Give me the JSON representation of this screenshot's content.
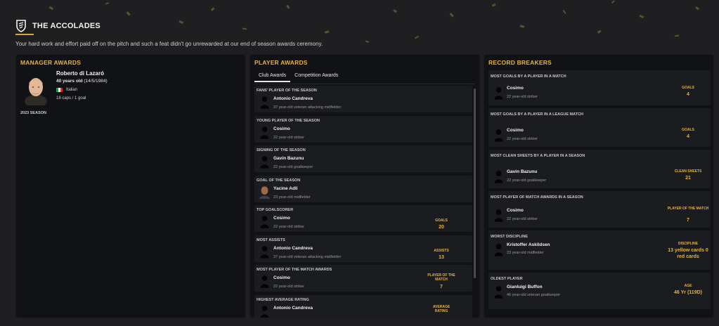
{
  "header": {
    "title": "THE ACCOLADES",
    "subtitle": "Your hard work and effort paid off on the pitch and such a feat didn't go unrewarded at our end of season awards ceremony.",
    "logo_icon": "accolades-shield-icon"
  },
  "colors": {
    "accent": "#e8b23a",
    "background": "#1f1f21",
    "panel": "#111215",
    "card": "#1b1c20"
  },
  "manager": {
    "title": "MANAGER AWARDS",
    "name": "Roberto di Lazaró",
    "age": "40 years old",
    "dob": "(14/5/1984)",
    "nationality": "Italian",
    "caps": "18 caps / 1 goal",
    "season": "2023 SEASON"
  },
  "player_awards": {
    "title": "PLAYER AWARDS",
    "tabs": [
      {
        "label": "Club Awards",
        "active": true
      },
      {
        "label": "Competition Awards",
        "active": false
      }
    ],
    "items": [
      {
        "category": "FANS' PLAYER OF THE SEASON",
        "name": "Antonio Candreva",
        "desc": "37 year-old veteran attacking midfielder",
        "stat_label": "",
        "stat_value": ""
      },
      {
        "category": "YOUNG PLAYER OF THE SEASON",
        "name": "Cosimo",
        "desc": "22 year-old striker",
        "stat_label": "",
        "stat_value": ""
      },
      {
        "category": "SIGNING OF THE SEASON",
        "name": "Gavin Bazunu",
        "desc": "22 year-old goalkeeper",
        "stat_label": "",
        "stat_value": ""
      },
      {
        "category": "GOAL OF THE SEASON",
        "name": "Yacine Adli",
        "desc": "23 year-old midfielder",
        "stat_label": "",
        "stat_value": ""
      },
      {
        "category": "TOP GOALSCORER",
        "name": "Cosimo",
        "desc": "22 year-old striker",
        "stat_label": "GOALS",
        "stat_value": "20"
      },
      {
        "category": "MOST ASSISTS",
        "name": "Antonio Candreva",
        "desc": "37 year-old veteran attacking midfielder",
        "stat_label": "ASSISTS",
        "stat_value": "13"
      },
      {
        "category": "MOST PLAYER OF THE MATCH AWARDS",
        "name": "Cosimo",
        "desc": "22 year-old striker",
        "stat_label": "PLAYER OF THE MATCH",
        "stat_value": "7"
      },
      {
        "category": "HIGHEST AVERAGE RATING",
        "name": "Antonio Candreva",
        "desc": "",
        "stat_label": "AVERAGE RATING",
        "stat_value": ""
      }
    ]
  },
  "records": {
    "title": "RECORD BREAKERS",
    "items": [
      {
        "category": "MOST GOALS BY A PLAYER IN A MATCH",
        "name": "Cosimo",
        "desc": "22 year-old striker",
        "stat_label": "GOALS",
        "stat_value": "4"
      },
      {
        "category": "MOST GOALS BY A PLAYER IN A LEAGUE MATCH",
        "name": "Cosimo",
        "desc": "22 year-old striker",
        "stat_label": "GOALS",
        "stat_value": "4"
      },
      {
        "category": "MOST CLEAN SHEETS BY A PLAYER IN A SEASON",
        "name": "Gavin Bazunu",
        "desc": "22 year-old goalkeeper",
        "stat_label": "CLEAN SHEETS",
        "stat_value": "21"
      },
      {
        "category": "MOST PLAYER OF MATCH AWARDS IN A SEASON",
        "name": "Cosimo",
        "desc": "22 year-old striker",
        "stat_label": "PLAYER OF THE MATCH",
        "stat_value": "7"
      },
      {
        "category": "WORST DISCIPLINE",
        "name": "Kristoffer Askildsen",
        "desc": "23 year-old midfielder",
        "stat_label": "DISCIPLINE",
        "stat_value": "13 yellow cards 0 red cards"
      },
      {
        "category": "OLDEST PLAYER",
        "name": "Gianluigi Buffon",
        "desc": "46 year-old veteran goalkeeper",
        "stat_label": "AGE",
        "stat_value": "46 Yr (119D)"
      }
    ]
  }
}
